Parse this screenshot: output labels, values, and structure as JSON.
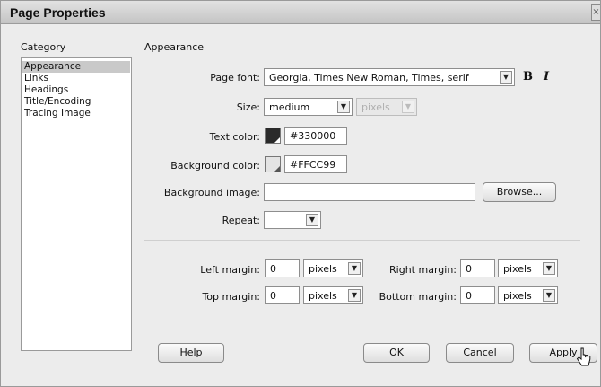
{
  "window": {
    "title": "Page Properties",
    "close_glyph": "×"
  },
  "category": {
    "header": "Category",
    "items": [
      {
        "label": "Appearance",
        "selected": true
      },
      {
        "label": "Links"
      },
      {
        "label": "Headings"
      },
      {
        "label": "Title/Encoding"
      },
      {
        "label": "Tracing Image"
      }
    ]
  },
  "panel": {
    "header": "Appearance"
  },
  "page_font": {
    "label": "Page font:",
    "value": "Georgia, Times New Roman, Times, serif",
    "bold": "B",
    "italic": "I"
  },
  "size": {
    "label": "Size:",
    "value": "medium",
    "unit": "pixels"
  },
  "text_color": {
    "label": "Text color:",
    "value": "#330000",
    "swatch": "#2a2a2a"
  },
  "background_color": {
    "label": "Background color:",
    "value": "#FFCC99",
    "swatch": "#e4e4e4"
  },
  "background_image": {
    "label": "Background image:",
    "value": "",
    "browse": "Browse..."
  },
  "repeat": {
    "label": "Repeat:",
    "value": ""
  },
  "margins": {
    "left": {
      "label": "Left margin:",
      "value": "0",
      "unit": "pixels"
    },
    "right": {
      "label": "Right margin:",
      "value": "0",
      "unit": "pixels"
    },
    "top": {
      "label": "Top margin:",
      "value": "0",
      "unit": "pixels"
    },
    "bottom": {
      "label": "Bottom margin:",
      "value": "0",
      "unit": "pixels"
    }
  },
  "buttons": {
    "help": "Help",
    "ok": "OK",
    "cancel": "Cancel",
    "apply": "Apply"
  }
}
